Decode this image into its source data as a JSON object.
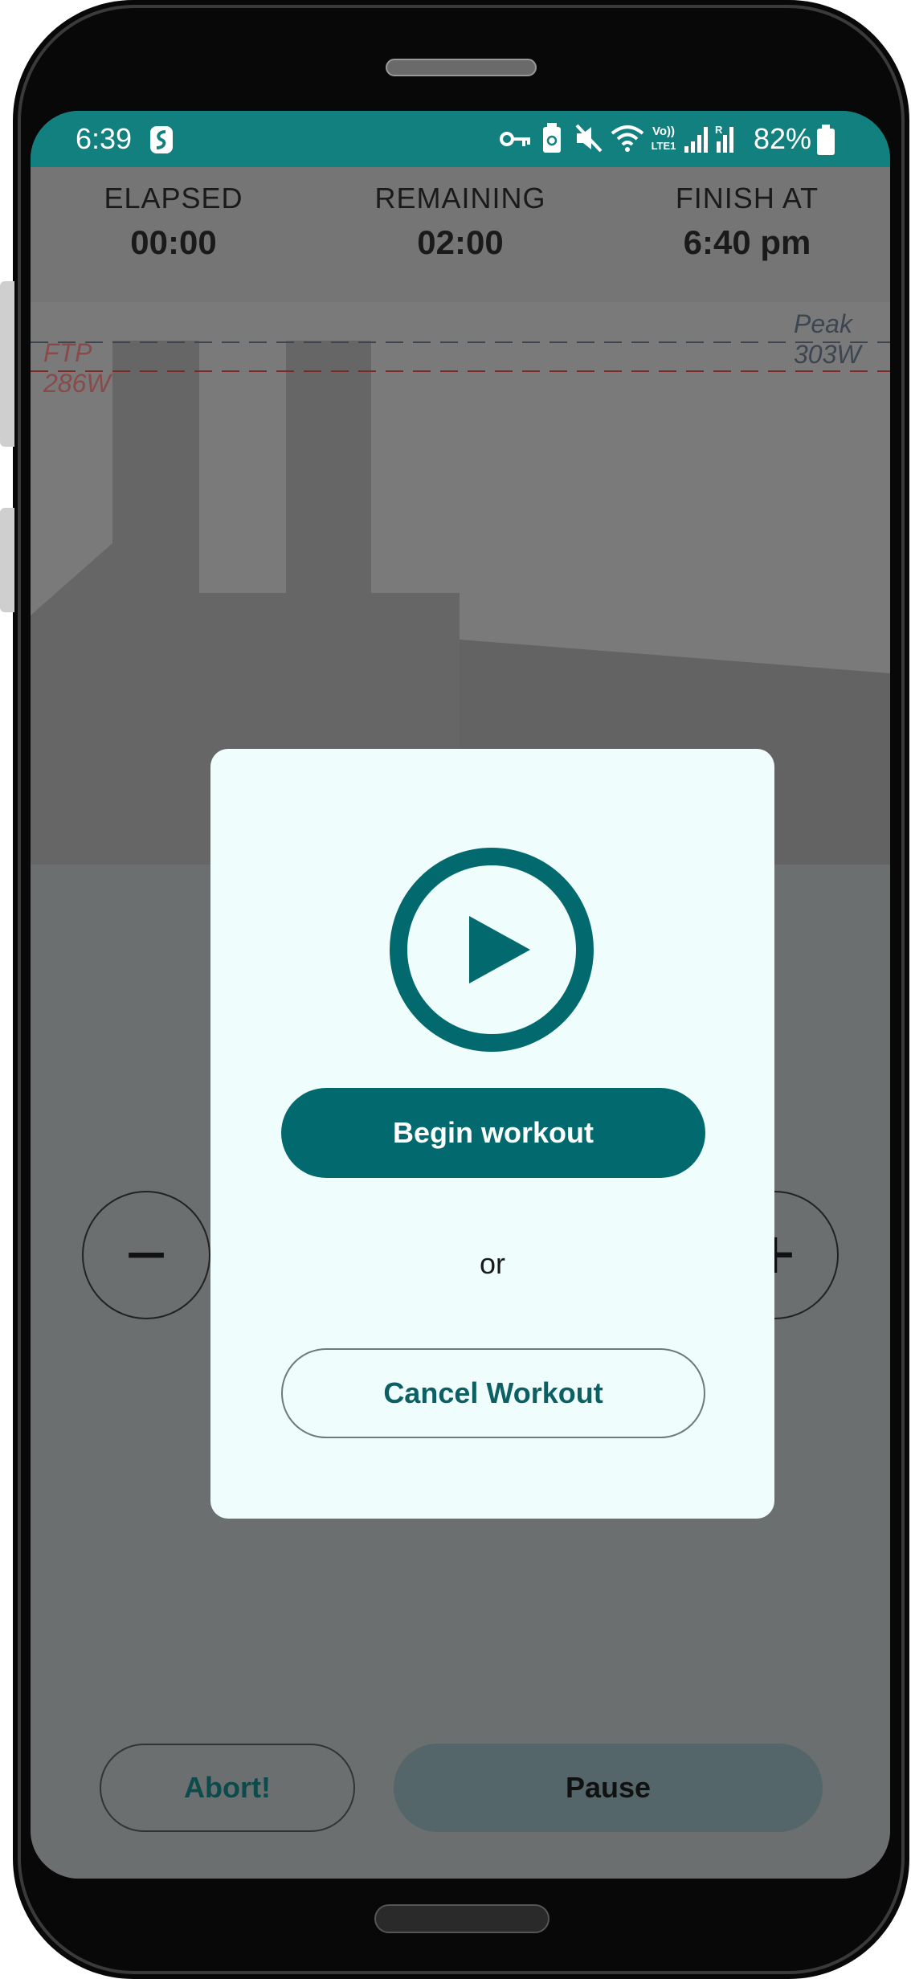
{
  "status_bar": {
    "time": "6:39",
    "battery_percent": "82%"
  },
  "stats": {
    "elapsed_label": "ELAPSED",
    "elapsed_value": "00:00",
    "remaining_label": "REMAINING",
    "remaining_value": "02:00",
    "finish_label": "FINISH AT",
    "finish_value": "6:40 pm"
  },
  "chart_labels": {
    "ftp_label": "FTP",
    "ftp_value": "286W",
    "peak_label": "Peak",
    "peak_value": "303W"
  },
  "controls": {
    "minus_symbol": "−",
    "plus_symbol": "+"
  },
  "dialog": {
    "begin_label": "Begin workout",
    "or_label": "or",
    "cancel_label": "Cancel Workout"
  },
  "bottom": {
    "abort_label": "Abort!",
    "pause_label": "Pause"
  },
  "colors": {
    "status_bar": "#138080",
    "accent": "#026a6e",
    "dialog_bg": "#effefd"
  },
  "icons": [
    "s-logo-icon",
    "key-icon",
    "battery-saver-icon",
    "mute-icon",
    "wifi-icon",
    "volte-icon",
    "signal-icon",
    "battery-icon",
    "play-icon"
  ]
}
